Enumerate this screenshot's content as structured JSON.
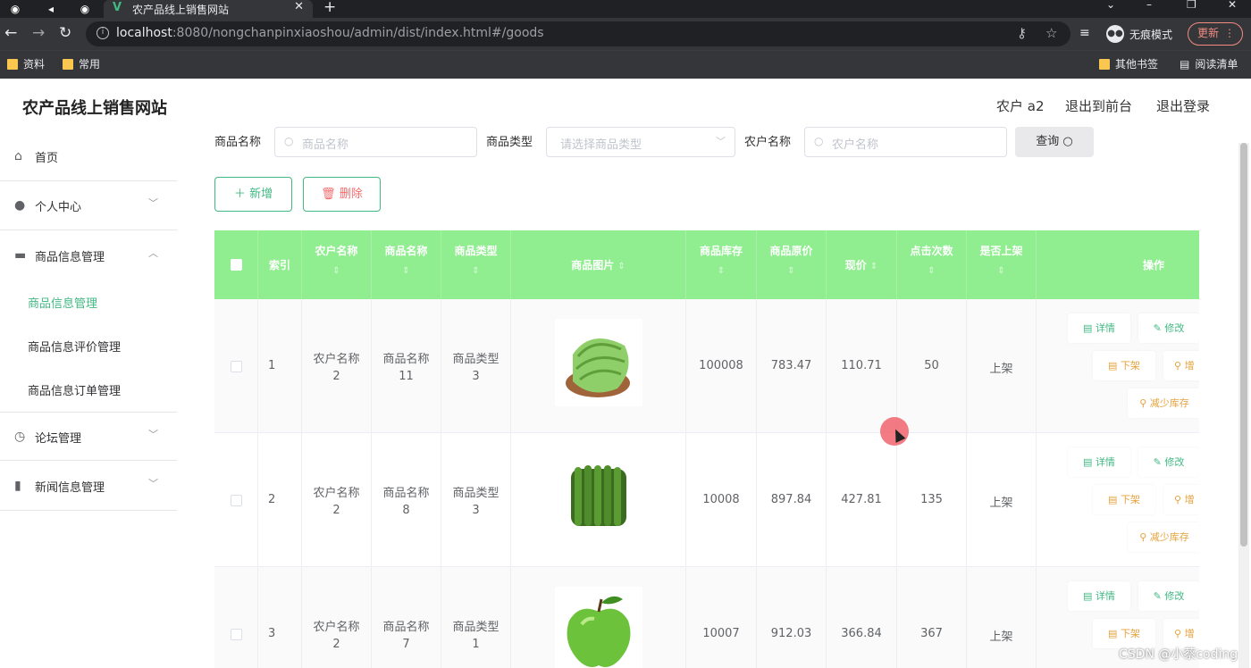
{
  "browser": {
    "tab_title": "农产品线上销售网站",
    "url_host": "localhost",
    "url_path": ":8080/nongchanpinxiaoshou/admin/dist/index.html#/goods",
    "incognito_label": "无痕模式",
    "update_label": "更新",
    "bookmarks": [
      "资料",
      "常用"
    ],
    "bookmarks_right": [
      "其他书签",
      "阅读清单"
    ]
  },
  "header": {
    "brand": "农产品线上销售网站",
    "user": "农户 a2",
    "to_front": "退出到前台",
    "logout": "退出登录"
  },
  "sidebar": {
    "items": [
      {
        "label": "首页",
        "icon": "home-icon"
      },
      {
        "label": "个人中心",
        "icon": "user-icon"
      },
      {
        "label": "商品信息管理",
        "icon": "monitor-icon"
      },
      {
        "label": "论坛管理",
        "icon": "clock-icon"
      },
      {
        "label": "新闻信息管理",
        "icon": "clipboard-icon"
      }
    ],
    "sub_items": [
      "商品信息管理",
      "商品信息评价管理",
      "商品信息订单管理"
    ]
  },
  "search": {
    "name_label": "商品名称",
    "name_placeholder": "商品名称",
    "type_label": "商品类型",
    "type_placeholder": "请选择商品类型",
    "farmer_label": "农户名称",
    "farmer_placeholder": "农户名称",
    "query_label": "查询"
  },
  "actions": {
    "add": "新增",
    "delete": "删除"
  },
  "table": {
    "columns": [
      "索引",
      "农户名称",
      "商品名称",
      "商品类型",
      "商品图片",
      "商品库存",
      "商品原价",
      "现价",
      "点击次数",
      "是否上架",
      "操作"
    ],
    "rows": [
      {
        "index": "1",
        "farmer": [
          "农户名称",
          "2"
        ],
        "name": [
          "商品名称",
          "11"
        ],
        "type": [
          "商品类型",
          "3"
        ],
        "stock": "100008",
        "orig": "783.47",
        "price": "110.71",
        "clicks": "50",
        "status": "上架"
      },
      {
        "index": "2",
        "farmer": [
          "农户名称",
          "2"
        ],
        "name": [
          "商品名称",
          "8"
        ],
        "type": [
          "商品类型",
          "3"
        ],
        "stock": "10008",
        "orig": "897.84",
        "price": "427.81",
        "clicks": "135",
        "status": "上架"
      },
      {
        "index": "3",
        "farmer": [
          "农户名称",
          "2"
        ],
        "name": [
          "商品名称",
          "7"
        ],
        "type": [
          "商品类型",
          "1"
        ],
        "stock": "10007",
        "orig": "912.03",
        "price": "366.84",
        "clicks": "367",
        "status": "上架"
      }
    ],
    "ops": {
      "detail": "详情",
      "edit": "修改",
      "off": "下架",
      "add_stock": "增",
      "reduce_stock": "减少库存"
    }
  },
  "watermark": "CSDN @小蔡coding",
  "colors": {
    "accent": "#42b883",
    "header_green": "#90ee90",
    "danger": "#f56c6c",
    "warning": "#e6a23c"
  }
}
